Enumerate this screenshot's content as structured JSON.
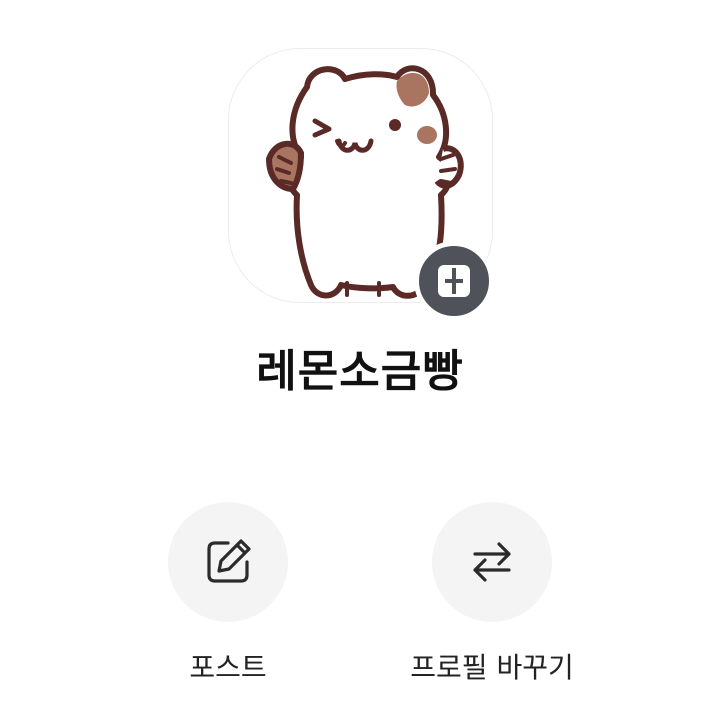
{
  "profile": {
    "name": "레몬소금빵",
    "avatar_icon": "cat-character-icon",
    "badge_icon": "profile-switch-badge-icon"
  },
  "actions": [
    {
      "label": "포스트",
      "icon": "edit-icon"
    },
    {
      "label": "프로필 바꾸기",
      "icon": "swap-arrows-icon"
    }
  ],
  "colors": {
    "badge": "#4f5359",
    "action_bg": "#f4f4f5",
    "outline": "#5a2a26",
    "patch": "#a97560"
  }
}
